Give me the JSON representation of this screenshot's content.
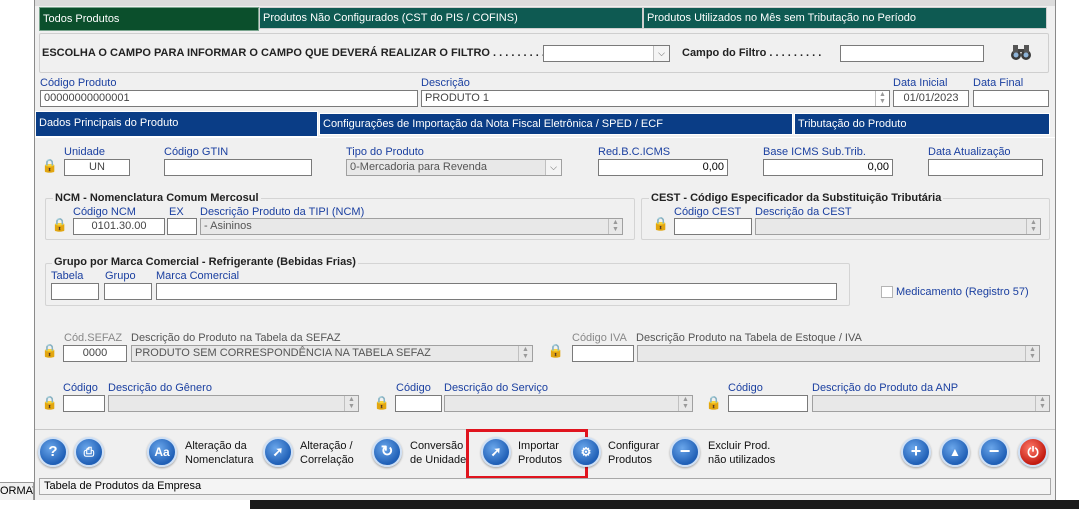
{
  "tabs_top": [
    "Todos Produtos",
    "Produtos Não Configurados (CST do PIS / COFINS)",
    "Produtos Utilizados no Mês sem Tributação no Período"
  ],
  "filter": {
    "label": "ESCOLHA O CAMPO PARA INFORMAR O CAMPO QUE DEVERÁ REALIZAR O FILTRO . . . . . . . . . :",
    "campo_label": "Campo do Filtro . . . . . . . . .",
    "select_value": "",
    "campo_value": ""
  },
  "search": {
    "codigo_label": "Código Produto",
    "codigo_value": "00000000000001",
    "descricao_label": "Descrição",
    "descricao_value": "PRODUTO 1",
    "data_inicial_label": "Data Inicial",
    "data_inicial_value": "01/01/2023",
    "data_final_label": "Data Final",
    "data_final_value": ""
  },
  "tabs_sub": [
    "Dados Principais do Produto",
    "Configurações de Importação da Nota Fiscal Eletrônica / SPED / ECF",
    "Tributação do Produto"
  ],
  "main": {
    "unidade_label": "Unidade",
    "unidade_value": "UN",
    "gtin_label": "Código GTIN",
    "gtin_value": "",
    "tipo_label": "Tipo do Produto",
    "tipo_value": "0-Mercadoria para Revenda",
    "redbc_label": "Red.B.C.ICMS",
    "redbc_value": "0,00",
    "baseicms_label": "Base ICMS Sub.Trib.",
    "baseicms_value": "0,00",
    "dataatual_label": "Data Atualização",
    "dataatual_value": ""
  },
  "ncm": {
    "title": "NCM - Nomenclatura Comum Mercosul",
    "codigo_label": "Código NCM",
    "codigo_value": "0101.30.00",
    "ex_label": "EX",
    "ex_value": "",
    "desc_label": "Descrição Produto da TIPI (NCM)",
    "desc_value": "- Asininos"
  },
  "cest": {
    "title": "CEST - Código Especificador da Substituição Tributária",
    "codigo_label": "Código CEST",
    "codigo_value": "",
    "desc_label": "Descrição da CEST",
    "desc_value": ""
  },
  "marca": {
    "title": "Grupo por Marca Comercial - Refrigerante (Bebidas Frias)",
    "tabela_label": "Tabela",
    "grupo_label": "Grupo",
    "marca_label": "Marca Comercial"
  },
  "medicamento_label": "Medicamento  (Registro  57)",
  "sefaz": {
    "cod_label": "Cód.SEFAZ",
    "cod_value": "0000",
    "desc_label": "Descrição do Produto na Tabela da SEFAZ",
    "desc_value": "PRODUTO SEM CORRESPONDÊNCIA NA TABELA SEFAZ"
  },
  "iva": {
    "cod_label": "Código IVA",
    "desc_label": "Descrição Produto na Tabela de Estoque / IVA"
  },
  "genero": {
    "cod_label": "Código",
    "desc_label": "Descrição do Gênero"
  },
  "servico": {
    "cod_label": "Código",
    "desc_label": "Descrição do Serviço"
  },
  "anp": {
    "cod_label": "Código",
    "desc_label": "Descrição do Produto da ANP"
  },
  "toolbar": {
    "alteracao_nom": [
      "Alteração da",
      "Nomenclatura"
    ],
    "alteracao_cor": [
      "Alteração /",
      "Correlação"
    ],
    "conversao": [
      "Conversão",
      "de Unidade"
    ],
    "importar": [
      "Importar",
      "Produtos"
    ],
    "configurar": [
      "Configurar",
      "Produtos"
    ],
    "excluir": [
      "Excluir Prod.",
      "não utilizados"
    ]
  },
  "status_text": "Tabela de Produtos da Empresa",
  "left_edge_text": "ORMAT",
  "colors": {
    "highlight_border": "#e0141e",
    "tab_green": "#0b4f2c",
    "tab_blue": "#0a3d86"
  }
}
